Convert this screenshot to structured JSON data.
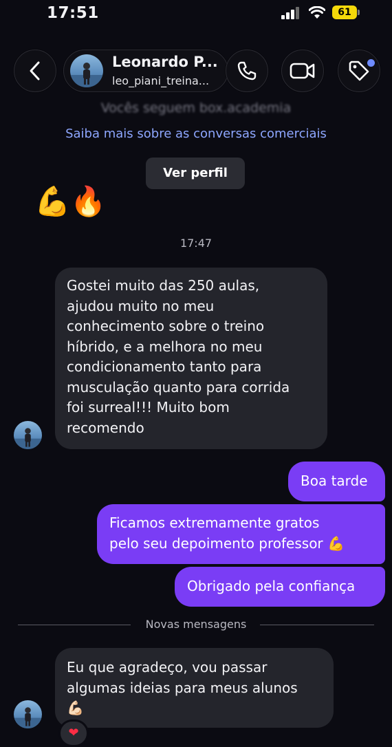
{
  "status_bar": {
    "time": "17:51",
    "battery": "61"
  },
  "header": {
    "name": "Leonardo P...",
    "username": "leo_piani_treina..."
  },
  "notice": {
    "blurred_line": "Vocês seguem box.academia",
    "business_link": "Saiba mais sobre as conversas comerciais",
    "view_profile": "Ver perfil"
  },
  "emoji_message": "💪🔥",
  "timestamp": "17:47",
  "messages": [
    {
      "from": "them",
      "lines": [
        "Gostei muito das 250 aulas,",
        "ajudou muito no meu",
        "conhecimento sobre o treino",
        "híbrido, e a melhora no meu",
        "condicionamento tanto para",
        "musculação quanto para corrida",
        "foi surreal!!! Muito bom",
        "recomendo"
      ]
    },
    {
      "from": "me",
      "lines": [
        "Boa tarde"
      ]
    },
    {
      "from": "me",
      "lines": [
        "Ficamos extremamente gratos",
        "pelo seu depoimento professor 💪"
      ]
    },
    {
      "from": "me",
      "lines": [
        "Obrigado pela confiança"
      ]
    },
    {
      "from": "them",
      "lines": [
        "Eu que agradeço, vou passar",
        "algumas ideias para meus alunos",
        "💪🏻"
      ],
      "reaction": "❤"
    }
  ],
  "divider": "Novas mensagens",
  "colors": {
    "outgoing": "#7a3df5",
    "incoming": "#24252c",
    "link": "#8ea7ff",
    "accent_dot": "#6e8bff"
  },
  "icons": [
    "back-arrow-icon",
    "phone-icon",
    "video-camera-icon",
    "tag-icon",
    "heart-reaction-icon"
  ]
}
